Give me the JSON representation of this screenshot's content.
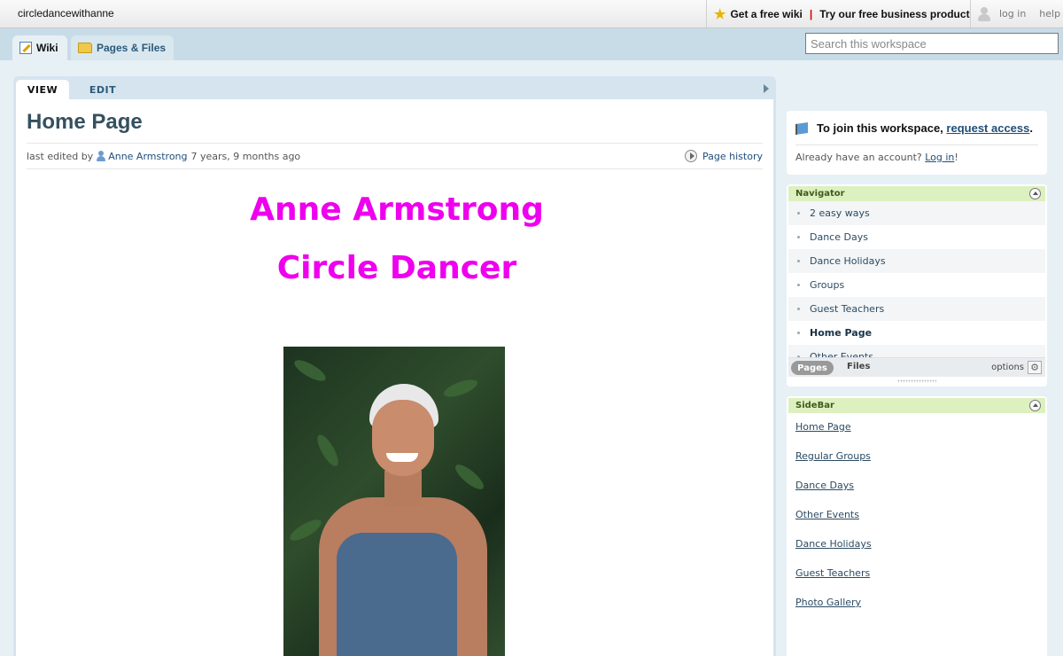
{
  "topbar": {
    "site_name": "circledancewithanne",
    "get_free_wiki": "Get a free wiki",
    "separator": "|",
    "business": "Try our free business product",
    "log_in": "log in",
    "help": "help"
  },
  "tabs": {
    "wiki": "Wiki",
    "pages_files": "Pages & Files"
  },
  "search": {
    "placeholder": "Search this workspace"
  },
  "page_tabs": {
    "view": "VIEW",
    "edit": "EDIT"
  },
  "page": {
    "title": "Home Page",
    "last_edited_prefix": "last edited by",
    "author": "Anne Armstrong",
    "edited_ago": "7 years, 9 months ago",
    "page_history": "Page history",
    "heading1": "Anne Armstrong",
    "heading2": "Circle Dancer"
  },
  "join": {
    "text": "To join this workspace,",
    "request_access": "request access",
    "period": ".",
    "already": "Already have an account?",
    "log_in": "Log in",
    "excl": "!"
  },
  "navigator": {
    "title": "Navigator",
    "items": [
      "2 easy ways",
      "Dance Days",
      "Dance Holidays",
      "Groups",
      "Guest Teachers",
      "Home Page",
      "Other Events"
    ],
    "current": "Home Page",
    "pages_tab": "Pages",
    "files_tab": "Files",
    "options": "options"
  },
  "sidebar": {
    "title": "SideBar",
    "links": [
      "Home Page",
      "Regular Groups",
      "Dance Days",
      "Other Events ",
      "Dance Holidays",
      "Guest Teachers",
      "Photo Gallery"
    ]
  },
  "colors": {
    "heading_magenta": "#ee00ee",
    "title_slate": "#35505f",
    "link_blue": "#1f4e79",
    "box_header_green": "#ddf0bf"
  }
}
